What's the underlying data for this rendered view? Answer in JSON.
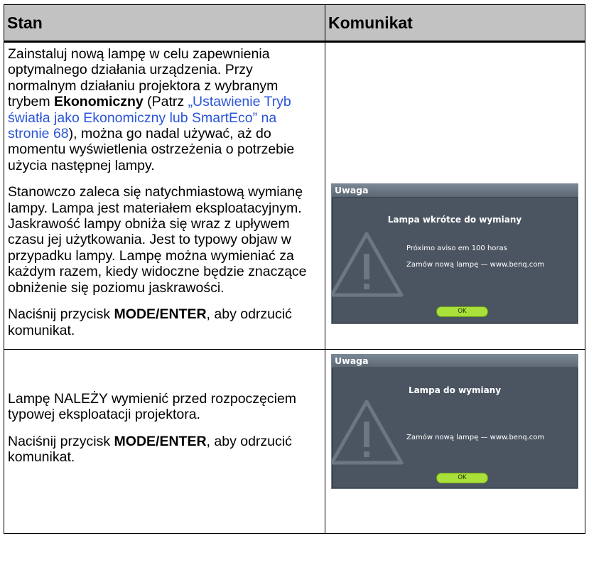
{
  "header": {
    "col1": "Stan",
    "col2": "Komunikat"
  },
  "row1": {
    "p1_a": "Zainstaluj nową lampę w celu zapewnienia optymalnego działania urządzenia. Przy normalnym działaniu projektora z wybranym trybem ",
    "p1_bold": "Ekonomiczny",
    "p1_b": " (Patrz ",
    "p1_link": "„Ustawienie Tryb światła jako Ekonomiczny lub SmartEco” na stronie 68",
    "p1_c": "), można go nadal używać, aż do momentu wyświetlenia ostrzeżenia o potrzebie użycia następnej lampy.",
    "p2": "Stanowczo zaleca się natychmiastową wymianę lampy. Lampa jest materiałem eksploatacyjnym. Jaskrawość lampy obniża się wraz z upływem czasu jej użytkowania. Jest to typowy objaw w przypadku lampy. Lampę można wymieniać za każdym razem, kiedy widoczne będzie znaczące obniżenie się poziomu jaskrawości.",
    "p3_a": "Naciśnij przycisk ",
    "p3_bold": "MODE/ENTER",
    "p3_b": ", aby odrzucić komunikat.",
    "osd": {
      "bar": "Uwaga",
      "title": "Lampa wkrótce do wymiany",
      "line1": "Próximo aviso em 100 horas",
      "line2": "Zamów nową lampę — www.benq.com",
      "ok": "OK"
    }
  },
  "row2": {
    "p1": "Lampę NALEŻY wymienić przed rozpoczęciem typowej eksploatacji projektora.",
    "p2_a": "Naciśnij przycisk ",
    "p2_bold": "MODE/ENTER",
    "p2_b": ", aby odrzucić komunikat.",
    "osd": {
      "bar": "Uwaga",
      "title": "Lampa do wymiany",
      "line1": "Zamów nową lampę — www.benq.com",
      "ok": "OK"
    }
  },
  "colors": {
    "header_bg": "#c2c2c2",
    "link": "#2b55d9",
    "osd_bg": "#4b5561",
    "ok_button": "#a9e03a"
  },
  "icons": {
    "warning": "warning-triangle-icon"
  }
}
